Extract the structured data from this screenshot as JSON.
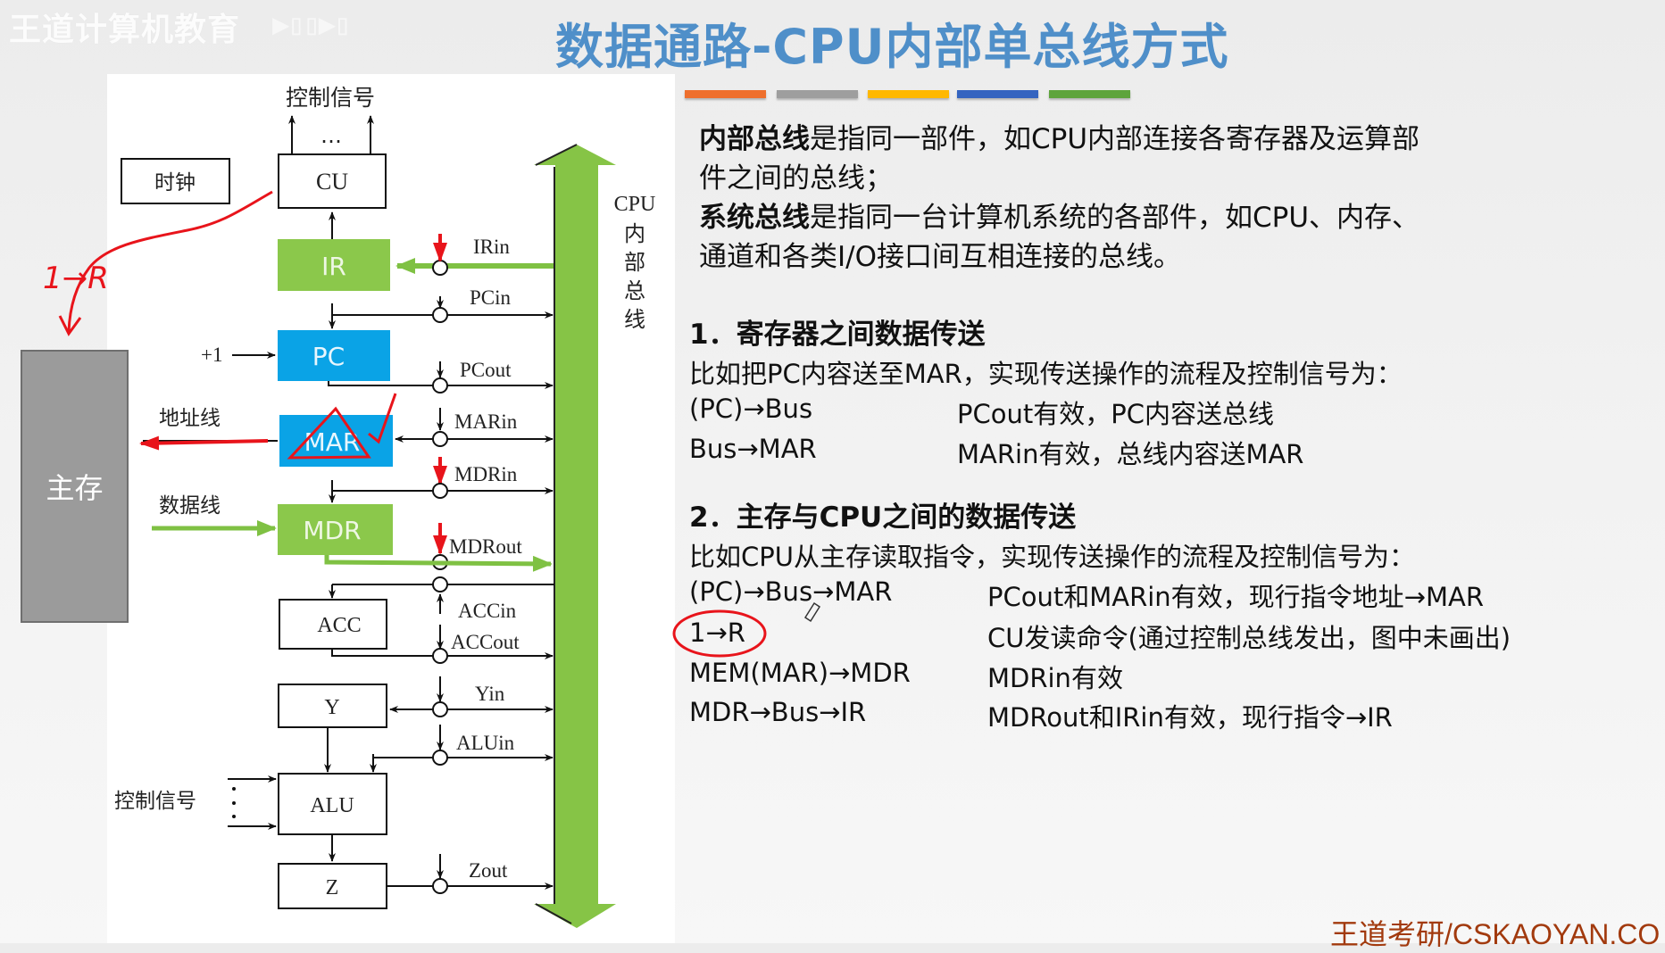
{
  "watermark": {
    "text": "王道计算机教育",
    "logo": "bilibili"
  },
  "slide": {
    "title": "数据通路-CPU内部单总线方式",
    "color_bars": [
      "#ee6f2d",
      "#9e9e9e",
      "#ffb800",
      "#3464c0",
      "#5ea43c"
    ]
  },
  "diagram": {
    "top_control_label": "控制信号",
    "ellipsis": "…",
    "clock_label": "时钟",
    "cu_label": "CU",
    "registers": {
      "ir": "IR",
      "pc": "PC",
      "mar": "MAR",
      "mdr": "MDR",
      "acc": "ACC",
      "y": "Y",
      "alu": "ALU",
      "z": "Z"
    },
    "main_memory": "主存",
    "plus_one": "+1",
    "address_line": "地址线",
    "data_line": "数据线",
    "alu_control_label": "控制信号",
    "bus_label_latin": "CPU",
    "bus_label_chars": [
      "内",
      "部",
      "总",
      "线"
    ],
    "signals": [
      "IRin",
      "PCin",
      "PCout",
      "MARin",
      "MDRin",
      "MDRout",
      "ACCin",
      "ACCout",
      "Yin",
      "ALUin",
      "Zout"
    ],
    "colors": {
      "green": "#8bc84b",
      "blue": "#0aa3e6",
      "bus": "#86c446",
      "annotation": "#e8141b"
    },
    "annotation_text": "1→R"
  },
  "content": {
    "para1_bold": "内部总线",
    "para1_rest_line1": "是指同一部件，如CPU内部连接各寄存器及运算部",
    "para1_line2": "件之间的总线；",
    "para2_bold": "系统总线",
    "para2_rest_line1": "是指同一台计算机系统的各部件，如CPU、内存、",
    "para2_line2": "通道和各类I/O接口间互相连接的总线。",
    "section1": {
      "heading": "1．寄存器之间数据传送",
      "intro": "比如把PC内容送至MAR，实现传送操作的流程及控制信号为：",
      "rows": [
        {
          "step": "(PC)→Bus",
          "desc": "PCout有效，PC内容送总线"
        },
        {
          "step": "Bus→MAR",
          "desc": "MARin有效，总线内容送MAR"
        }
      ]
    },
    "section2": {
      "heading": "2．主存与CPU之间的数据传送",
      "intro": "比如CPU从主存读取指令，实现传送操作的流程及控制信号为：",
      "rows": [
        {
          "step": "(PC)→Bus→MAR",
          "desc": "PCout和MARin有效，现行指令地址→MAR"
        },
        {
          "step": "1→R",
          "desc": "CU发读命令(通过控制总线发出，图中未画出)"
        },
        {
          "step": "MEM(MAR)→MDR",
          "desc": "MDRin有效"
        },
        {
          "step": "MDR→Bus→IR",
          "desc": "MDRout和IRin有效，现行指令→IR"
        }
      ]
    }
  },
  "footer": {
    "brand": "王道考研/CSKAOYAN.CO"
  }
}
